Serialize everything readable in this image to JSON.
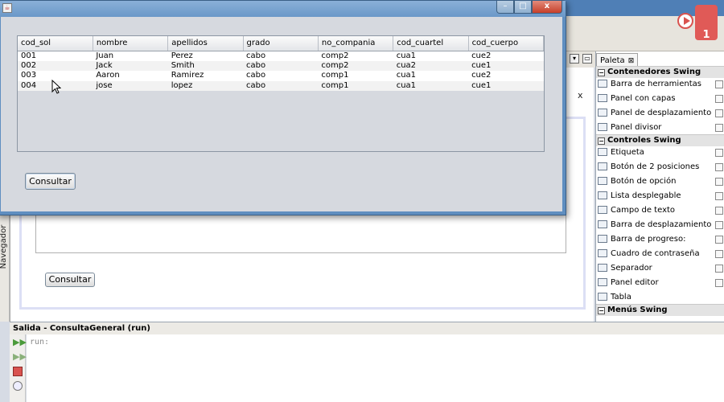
{
  "ide": {
    "navigator_tab": "Navegador",
    "palette": {
      "tab_label": "Paleta",
      "tab_close": "⊠",
      "categories": [
        {
          "label": "Contenedores Swing",
          "items": [
            "Barra de herramientas",
            "Panel con capas",
            "Panel de desplazamiento",
            "Panel divisor"
          ]
        },
        {
          "label": "Controles Swing",
          "items": [
            "Etiqueta",
            "Botón de 2 posiciones",
            "Botón de opción",
            "Lista desplegable",
            "Campo de texto",
            "Barra de desplazamiento",
            "Barra de progreso:",
            "Cuadro de contraseña",
            "Separador",
            "Panel editor",
            "Tabla"
          ]
        },
        {
          "label": "Menús Swing",
          "items": []
        }
      ]
    },
    "form_button_label": "Consultar",
    "editor_close": "x",
    "output": {
      "header": "Salida - ConsultaGeneral (run)",
      "run_text": "run:"
    },
    "record_badge_number": "1"
  },
  "window": {
    "min_label": "–",
    "max_label": "□",
    "close_label": "x"
  },
  "table": {
    "columns": [
      "cod_sol",
      "nombre",
      "apellidos",
      "grado",
      "no_compania",
      "cod_cuartel",
      "cod_cuerpo"
    ],
    "rows": [
      [
        "001",
        "Juan",
        "Perez",
        "cabo",
        "comp2",
        "cua1",
        "cue2"
      ],
      [
        "002",
        "Jack",
        "Smith",
        "cabo",
        "comp2",
        "cua2",
        "cue1"
      ],
      [
        "003",
        "Aaron",
        "Ramirez",
        "cabo",
        "comp1",
        "cua1",
        "cue2"
      ],
      [
        "004",
        "jose",
        "lopez",
        "cabo",
        "comp1",
        "cua1",
        "cue1"
      ]
    ]
  },
  "consultar_label": "Consultar",
  "colors": {
    "window_frame": "#5f8ec0",
    "window_content": "#d6d9df",
    "close_button": "#c6402a",
    "record_badge": "#e05a57"
  }
}
